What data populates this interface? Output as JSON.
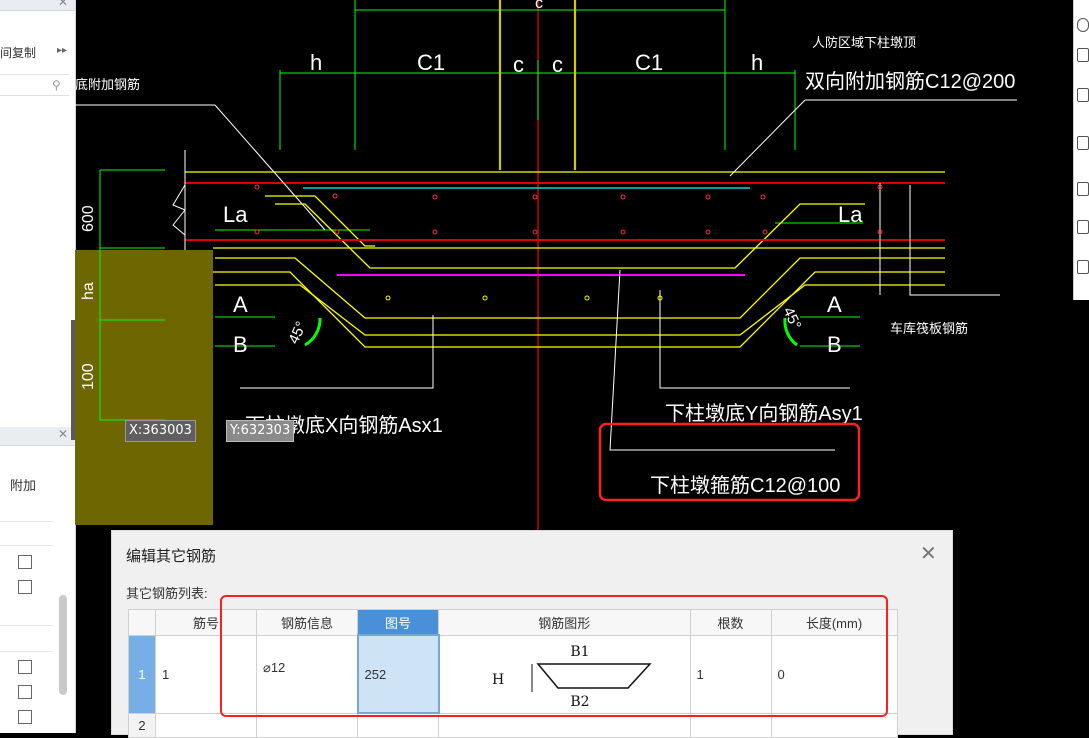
{
  "left_panel": {
    "copy_label": "间复制",
    "column_header": "附加"
  },
  "cad": {
    "dim_labels": [
      "c",
      "h",
      "C1",
      "c",
      "c",
      "C1",
      "h"
    ],
    "vertical_dims": [
      "600",
      "ha",
      "100"
    ],
    "labels": {
      "La_left": "La",
      "La_right": "La",
      "A_left": "A",
      "B_left": "B",
      "A_right": "A",
      "B_right": "B",
      "angle_left": "45°",
      "angle_right": "45°",
      "top_left_note": "底附加钢筋",
      "top_right_note1": "人防区域下柱墩顶",
      "top_right_note2": "双向附加钢筋C12@200",
      "right_note": "车库筏板钢筋",
      "asx": "下柱墩底X向钢筋Asx1",
      "asy": "下柱墩底Y向钢筋Asy1",
      "stirrup": "下柱墩箍筋C12@100"
    },
    "coord_x": "X:363003",
    "coord_y": "Y:632303",
    "colors": {
      "yellow": "#ffff00",
      "red": "#ff0000",
      "green": "#00ff00",
      "white": "#ffffff",
      "magenta": "#ff00ff",
      "cyan": "#00ffff",
      "olive": "#6e6600"
    }
  },
  "dialog": {
    "title": "编辑其它钢筋",
    "close": "✕",
    "list_label": "其它钢筋列表:",
    "columns": [
      "筋号",
      "钢筋信息",
      "图号",
      "钢筋图形",
      "根数",
      "长度(mm)"
    ],
    "rows": [
      {
        "num": "1",
        "bar_no": "1",
        "info": "⌀12",
        "fig_no": "252",
        "shape_top": "B1",
        "shape_bottom": "B2",
        "shape_h": "H",
        "count": "1",
        "length": "0"
      },
      {
        "num": "2",
        "bar_no": "",
        "info": "",
        "fig_no": "",
        "count": "",
        "length": ""
      }
    ]
  }
}
